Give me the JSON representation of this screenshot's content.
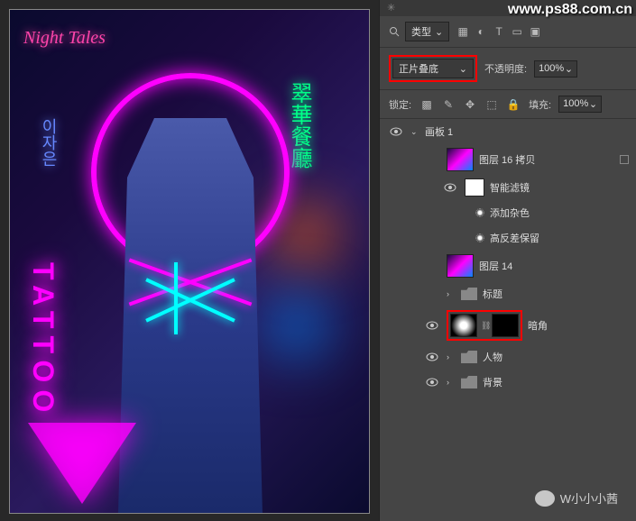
{
  "watermark": "www.ps88.com.cn",
  "wechat_signature": "W小小小茜",
  "canvas": {
    "night_text": "Night Tales",
    "tattoo_text": "TATTOO",
    "sign1": "翠華餐廳",
    "sign2": "이자은"
  },
  "panel": {
    "search_label": "类型",
    "blend_mode": "正片叠底",
    "opacity_label": "不透明度:",
    "opacity_value": "100%",
    "lock_label": "锁定:",
    "fill_label": "填充:",
    "fill_value": "100%"
  },
  "layers": {
    "artboard": "画板 1",
    "layer16copy": "图层 16 拷贝",
    "smart_filters": "智能滤镜",
    "add_noise": "添加杂色",
    "high_pass": "高反差保留",
    "layer14": "图层 14",
    "title_group": "标题",
    "vignette": "暗角",
    "person_group": "人物",
    "bg_group": "背景"
  }
}
